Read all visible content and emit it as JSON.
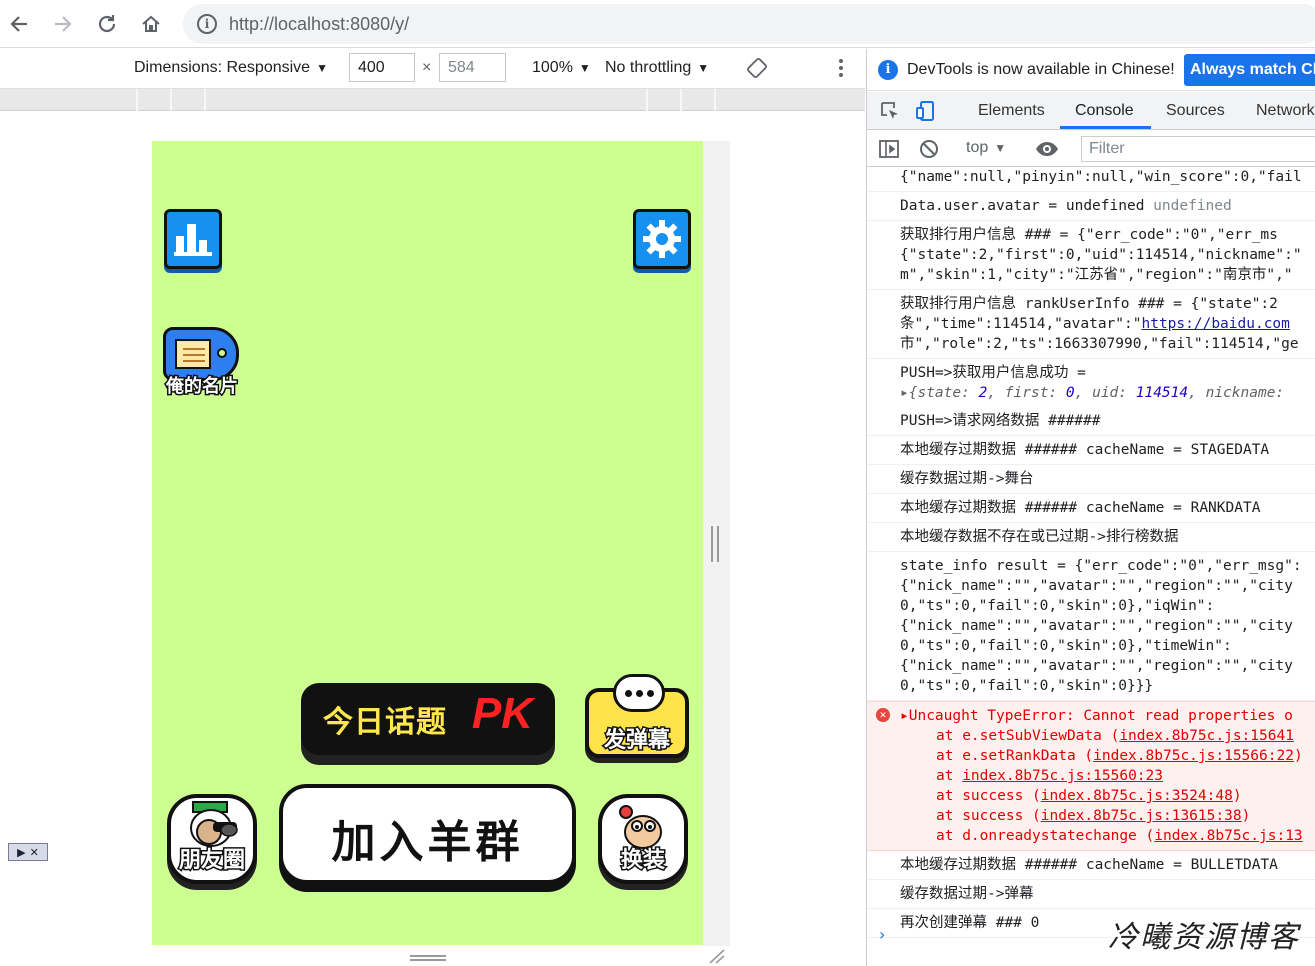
{
  "browser": {
    "url": "http://localhost:8080/y/"
  },
  "device_toolbar": {
    "dimensions_label": "Dimensions: Responsive",
    "width": "400",
    "times": "×",
    "height": "584",
    "zoom": "100%",
    "throttling": "No throttling"
  },
  "game": {
    "topic_pk_text": "今日话题",
    "topic_pk_suffix": "PK",
    "danmu_label": "发弹幕",
    "join_group_label": "加入羊群",
    "moments_label": "朋友圈",
    "dressup_label": "换装",
    "my_card_label": "俺的名片"
  },
  "devtools": {
    "info_message": "DevTools is now available in Chinese!",
    "info_button": "Always match Ch",
    "tabs": [
      "Elements",
      "Console",
      "Sources",
      "Network"
    ],
    "active_tab": "Console",
    "context": "top",
    "filter_placeholder": "Filter",
    "console_lines": [
      "{\"name\":null,\"pinyin\":null,\"win_score\":0,\"fail",
      " Data.user.avatar = undefined ",
      "获取排行用户信息 ### =  {\"err_code\":\"0\",\"err_ms",
      "{\"state\":2,\"first\":0,\"uid\":114514,\"nickname\":\"",
      "m\",\"skin\":1,\"city\":\"江苏省\",\"region\":\"南京市\",\"",
      "获取排行用户信息 rankUserInfo ### =  {\"state\":2",
      "条\",\"time\":114514,\"avatar\":\"",
      "https://baidu.com",
      "市\",\"role\":2,\"ts\":1663307990,\"fail\":114514,\"ge",
      "PUSH=>获取用户信息成功  =",
      "{state: ",
      "2",
      ", first: ",
      "0",
      ", uid: ",
      "114514",
      ", nickname: ",
      "PUSH=>请求网络数据 ######",
      "本地缓存过期数据 ###### cacheName =  STAGEDATA",
      "缓存数据过期->舞台",
      "本地缓存过期数据 ###### cacheName =  RANKDATA",
      "本地缓存数据不存在或已过期->排行榜数据",
      "state_info result = {\"err_code\":\"0\",\"err_msg\":",
      "{\"nick_name\":\"\",\"avatar\":\"\",\"region\":\"\",\"city",
      "0,\"ts\":0,\"fail\":0,\"skin\":0},\"iqWin\":",
      "{\"nick_name\":\"\",\"avatar\":\"\",\"region\":\"\",\"city",
      "0,\"ts\":0,\"fail\":0,\"skin\":0},\"timeWin\":",
      "{\"nick_name\":\"\",\"avatar\":\"\",\"region\":\"\",\"city",
      "0,\"ts\":0,\"fail\":0,\"skin\":0}}}",
      "▸Uncaught TypeError: Cannot read properties o",
      "at e.setSubViewData (",
      "index.8b75c.js:15641",
      "at e.setRankData (",
      "index.8b75c.js:15566:22",
      "at ",
      "index.8b75c.js:15560:23",
      "at success (",
      "index.8b75c.js:3524:48",
      "at success (",
      "index.8b75c.js:13615:38",
      "at d.onreadystatechange (",
      "index.8b75c.js:13",
      "本地缓存过期数据 ###### cacheName =  BULLETDATA",
      "缓存数据过期->弹幕",
      "再次创建弹幕 ### 0",
      "undefined",
      ")"
    ]
  },
  "watermark": "冷曦资源博客",
  "colors": {
    "game_bg": "#ccff8f",
    "accent": "#1a73e8",
    "error": "#e50000"
  }
}
